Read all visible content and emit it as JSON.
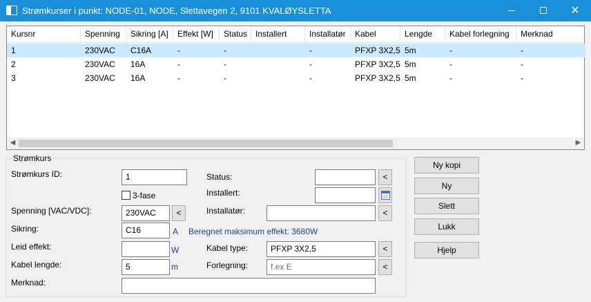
{
  "window": {
    "title": "Strømkurser i punkt: NODE-01, NODE, Slettavegen 2, 9101 KVALØYSLETTA",
    "minimize_icon": "minimize-icon",
    "maximize_icon": "maximize-icon",
    "close_glyph": "✕"
  },
  "table": {
    "columns": [
      "Kursnr",
      "Spenning",
      "Sikring [A]",
      "Effekt [W]",
      "Status",
      "Installert",
      "Installatør",
      "Kabel",
      "Lengde",
      "Kabel forlegning",
      "Merknad"
    ],
    "rows": [
      [
        "1",
        "230VAC",
        "C16A",
        "-",
        "-",
        "",
        "-",
        "PFXP 3X2,5",
        "5m",
        "-",
        "-"
      ],
      [
        "2",
        "230VAC",
        "16A",
        "-",
        "-",
        "",
        "-",
        "PFXP 3X2,5",
        "5m",
        "-",
        "-"
      ],
      [
        "3",
        "230VAC",
        "16A",
        "-",
        "-",
        "",
        "-",
        "PFXP 3X2,5",
        "5m",
        "-",
        "-"
      ]
    ],
    "selected_row": 0,
    "scroll_left": "◀",
    "scroll_right": "▶"
  },
  "form": {
    "group_title": "Strømkurs",
    "kurs_id_label": "Strømkurs ID:",
    "kurs_id_value": "1",
    "trefase_label": "3-fase",
    "spenning_label": "Spenning [VAC/VDC]:",
    "spenning_value": "230VAC",
    "sikring_label": "Sikring:",
    "sikring_value": "C16",
    "sikring_unit": "A",
    "beregnet_text": "Beregnet maksimum effekt: 3680W",
    "leid_label": "Leid effekt:",
    "leid_value": "",
    "leid_unit": "W",
    "kabel_lengde_label": "Kabel lengde:",
    "kabel_lengde_value": "5",
    "kabel_lengde_unit": "m",
    "merknad_label": "Merknad:",
    "merknad_value": "",
    "status_label": "Status:",
    "status_value": "",
    "installert_label": "Installert:",
    "installert_value": "",
    "installator_label": "Installatør:",
    "installator_value": "",
    "kabel_type_label": "Kabel type:",
    "kabel_type_value": "PFXP 3X2,5",
    "forlegning_label": "Forlegning:",
    "forlegning_placeholder": "f.ex E",
    "picker_glyph": "<"
  },
  "buttons": {
    "ny_kopi": "Ny kopi",
    "ny": "Ny",
    "slett": "Slett",
    "lukk": "Lukk",
    "hjelp": "Hjelp"
  }
}
